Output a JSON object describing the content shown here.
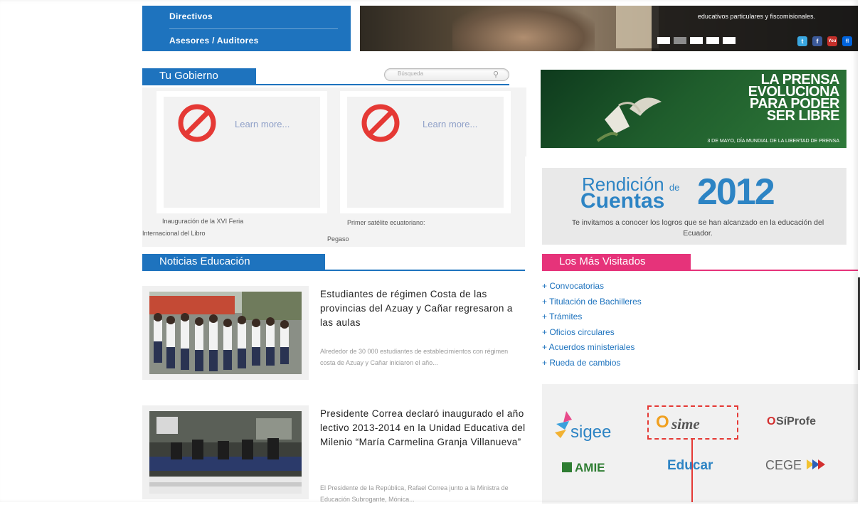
{
  "top_nav": {
    "items": [
      "Directivos",
      "Asesores / Auditores"
    ]
  },
  "hero": {
    "caption": "educativos particulares y fiscomisionales.",
    "social": [
      "t",
      "f",
      "You",
      "fl"
    ]
  },
  "gobierno": {
    "title": "Tu Gobierno",
    "search_placeholder": "Búsqueda",
    "cards": [
      {
        "link": "Learn more...",
        "caption_line1": "Inauguración de la XVI Feria",
        "caption_line2": "Internacional del Libro"
      },
      {
        "link": "Learn more...",
        "caption_line1": "Primer satélite ecuatoriano:",
        "caption_line2": "Pegaso"
      }
    ]
  },
  "noticias": {
    "title": "Noticias Educación",
    "items": [
      {
        "title": "Estudiantes de régimen Costa de las provincias del Azuay y Cañar regresaron a las aulas",
        "excerpt": "Alrededor de 30 000 estudiantes de establecimientos con régimen costa de Azuay y Cañar iniciaron el año..."
      },
      {
        "title": "Presidente Correa declaró inaugurado el año lectivo 2013-2014 en la Unidad Educativa del Milenio “María Carmelina Granja Villanueva”",
        "excerpt": "El Presidente de la República, Rafael Correa junto a la Ministra de Educación Subrogante, Mónica..."
      }
    ]
  },
  "banners": {
    "prensa_headline": [
      "LA PRENSA",
      "EVOLUCIONA",
      "PARA PODER",
      "SER LIBRE"
    ],
    "prensa_sub": "3 DE MAYO, DÍA MUNDIAL DE LA LIBERTAD DE PRENSA",
    "rendicion_word1": "Rendición",
    "rendicion_de": "de",
    "rendicion_word2": "Cuentas",
    "rendicion_year": "2012",
    "rendicion_text": "Te invitamos a conocer los logros que se han alcanzado en la educación del Ecuador."
  },
  "mas_visitados": {
    "title": "Los Más Visitados",
    "links": [
      "+ Convocatorias",
      "+ Titulación de Bachilleres",
      "+ Trámites",
      "+ Oficios circulares",
      "+ Acuerdos ministeriales",
      "+ Rueda de cambios"
    ]
  },
  "logos": {
    "sigee": "sigee",
    "sime_o": "O",
    "sime": "sime",
    "sifprofe_o": "O",
    "sifprofe": "SíProfe",
    "amie": "AMIE",
    "educar": "Educar",
    "cege": "CEGE"
  },
  "colors": {
    "blue": "#1e73be",
    "pink": "#e6337a",
    "highlight": "#e53935"
  }
}
